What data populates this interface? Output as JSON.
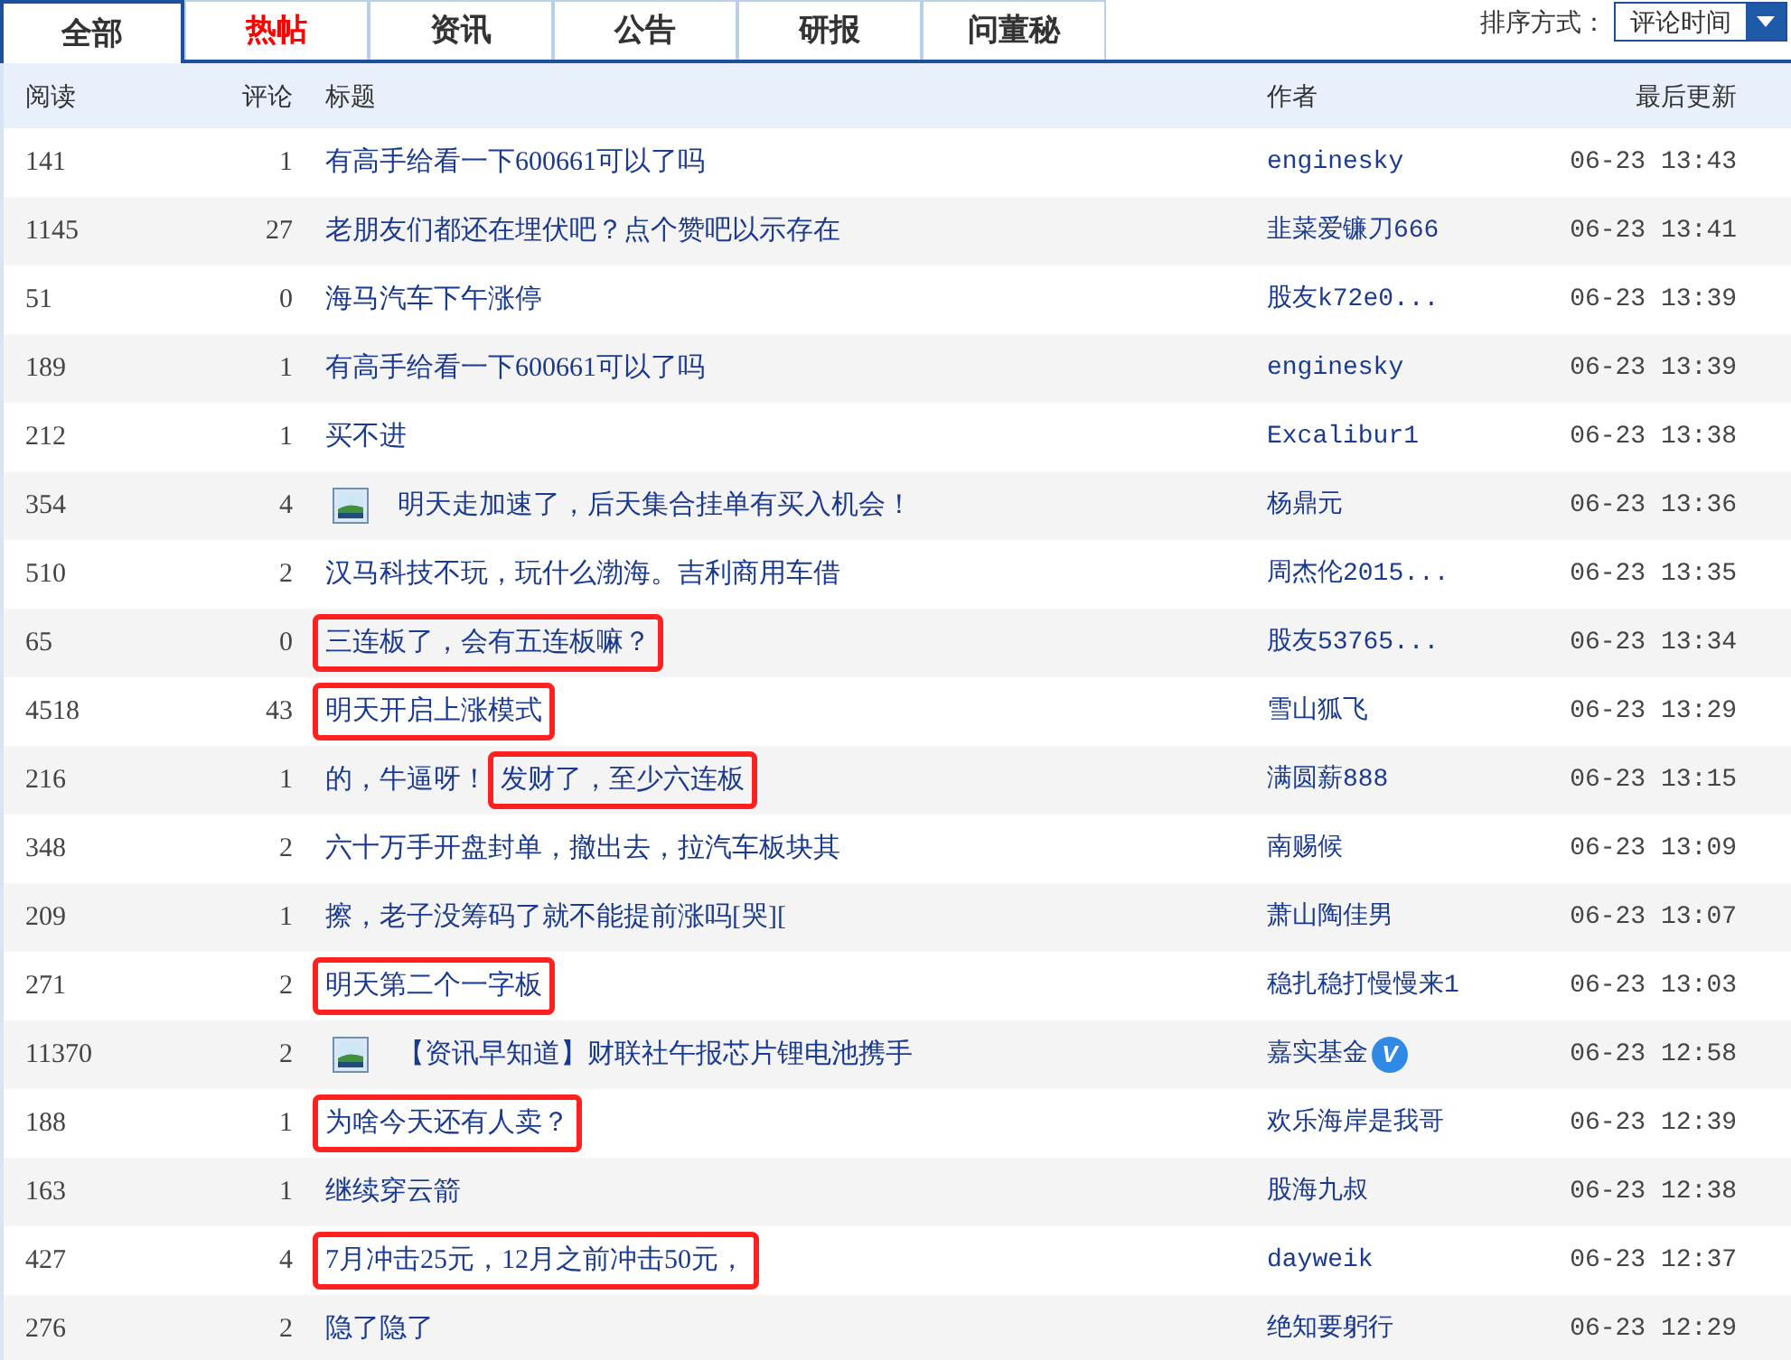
{
  "tabs": [
    {
      "label": "全部",
      "selected": true,
      "hot": false
    },
    {
      "label": "热帖",
      "selected": false,
      "hot": true
    },
    {
      "label": "资讯",
      "selected": false,
      "hot": false
    },
    {
      "label": "公告",
      "selected": false,
      "hot": false
    },
    {
      "label": "研报",
      "selected": false,
      "hot": false
    },
    {
      "label": "问董秘",
      "selected": false,
      "hot": false
    }
  ],
  "sort": {
    "label": "排序方式：",
    "value": "评论时间"
  },
  "columns": [
    "阅读",
    "评论",
    "标题",
    "作者",
    "最后更新"
  ],
  "rows": [
    {
      "reads": "141",
      "comments": "1",
      "has_image": false,
      "title_parts": [
        {
          "text": "有高手给看一下600661可以了吗",
          "marked": false
        }
      ],
      "author": "enginesky",
      "updated": "06-23 13:43"
    },
    {
      "reads": "1145",
      "comments": "27",
      "has_image": false,
      "title_parts": [
        {
          "text": "老朋友们都还在埋伏吧？点个赞吧以示存在",
          "marked": false
        }
      ],
      "author": "韭菜爱镰刀666",
      "updated": "06-23 13:41"
    },
    {
      "reads": "51",
      "comments": "0",
      "has_image": false,
      "title_parts": [
        {
          "text": "海马汽车下午涨停",
          "marked": false
        }
      ],
      "author": "股友k72e0...",
      "updated": "06-23 13:39"
    },
    {
      "reads": "189",
      "comments": "1",
      "has_image": false,
      "title_parts": [
        {
          "text": "有高手给看一下600661可以了吗",
          "marked": false
        }
      ],
      "author": "enginesky",
      "updated": "06-23 13:39"
    },
    {
      "reads": "212",
      "comments": "1",
      "has_image": false,
      "title_parts": [
        {
          "text": "买不进",
          "marked": false
        }
      ],
      "author": "Excalibur1",
      "updated": "06-23 13:38"
    },
    {
      "reads": "354",
      "comments": "4",
      "has_image": true,
      "title_parts": [
        {
          "text": "明天走加速了，后天集合挂单有买入机会！",
          "marked": false
        }
      ],
      "author": "杨鼎元",
      "updated": "06-23 13:36"
    },
    {
      "reads": "510",
      "comments": "2",
      "has_image": false,
      "title_parts": [
        {
          "text": "汉马科技不玩，玩什么渤海。吉利商用车借",
          "marked": false
        }
      ],
      "author": "周杰伦2015...",
      "updated": "06-23 13:35"
    },
    {
      "reads": "65",
      "comments": "0",
      "has_image": false,
      "title_parts": [
        {
          "text": "三连板了，会有五连板嘛？",
          "marked": true
        }
      ],
      "author": "股友53765...",
      "updated": "06-23 13:34"
    },
    {
      "reads": "4518",
      "comments": "43",
      "has_image": false,
      "title_parts": [
        {
          "text": "明天开启上涨模式",
          "marked": true
        }
      ],
      "author": "雪山狐飞",
      "updated": "06-23 13:29"
    },
    {
      "reads": "216",
      "comments": "1",
      "has_image": false,
      "title_parts": [
        {
          "text": "的，牛逼呀！",
          "marked": false
        },
        {
          "text": "发财了，至少六连板",
          "marked": true
        }
      ],
      "author": "满圆薪888",
      "updated": "06-23 13:15"
    },
    {
      "reads": "348",
      "comments": "2",
      "has_image": false,
      "title_parts": [
        {
          "text": "六十万手开盘封单，撤出去，拉汽车板块其",
          "marked": false
        }
      ],
      "author": "南赐候",
      "updated": "06-23 13:09"
    },
    {
      "reads": "209",
      "comments": "1",
      "has_image": false,
      "title_parts": [
        {
          "text": "擦，老子没筹码了就不能提前涨吗[哭][",
          "marked": false
        }
      ],
      "author": "萧山陶佳男",
      "updated": "06-23 13:07"
    },
    {
      "reads": "271",
      "comments": "2",
      "has_image": false,
      "title_parts": [
        {
          "text": "明天第二个一字板",
          "marked": true
        }
      ],
      "author": "稳扎稳打慢慢来1",
      "updated": "06-23 13:03"
    },
    {
      "reads": "11370",
      "comments": "2",
      "has_image": true,
      "title_parts": [
        {
          "text": "【资讯早知道】财联社午报芯片锂电池携手",
          "marked": false
        }
      ],
      "author": "嘉实基金",
      "badge": "V",
      "updated": "06-23 12:58"
    },
    {
      "reads": "188",
      "comments": "1",
      "has_image": false,
      "title_parts": [
        {
          "text": "为啥今天还有人卖？",
          "marked": true
        }
      ],
      "author": "欢乐海岸是我哥",
      "updated": "06-23 12:39"
    },
    {
      "reads": "163",
      "comments": "1",
      "has_image": false,
      "title_parts": [
        {
          "text": "继续穿云箭",
          "marked": false
        }
      ],
      "author": "股海九叔",
      "updated": "06-23 12:38"
    },
    {
      "reads": "427",
      "comments": "4",
      "has_image": false,
      "title_parts": [
        {
          "text": "7月冲击25元，12月之前冲击50元，",
          "marked": true
        }
      ],
      "author": "dayweik",
      "updated": "06-23 12:37"
    },
    {
      "reads": "276",
      "comments": "2",
      "has_image": false,
      "title_parts": [
        {
          "text": "隐了隐了",
          "marked": false
        }
      ],
      "author": "绝知要躬行",
      "updated": "06-23 12:29"
    }
  ]
}
